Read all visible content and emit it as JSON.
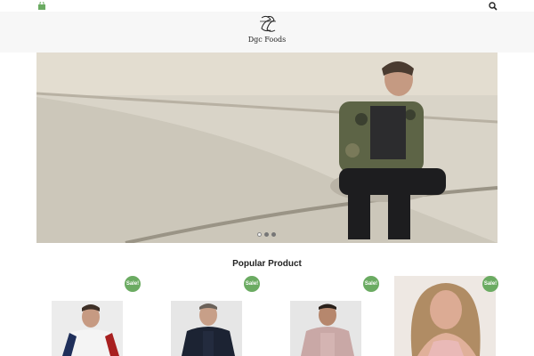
{
  "topbar": {
    "cart_icon": "shopping-bag-icon",
    "search_icon": "search-icon",
    "accent": "#6bab62"
  },
  "header": {
    "logo_monogram": "SS",
    "brand_name": "Dgc Foods"
  },
  "hero": {
    "slide_count": 3,
    "active_slide": 2
  },
  "popular": {
    "title": "Popular Product",
    "products": [
      {
        "badge": "Sale!"
      },
      {
        "badge": "Sale!"
      },
      {
        "badge": "Sale!"
      },
      {
        "badge": "Sale!"
      }
    ]
  },
  "colors": {
    "sale_badge": "#6bab62",
    "header_bg": "#f7f7f7"
  }
}
